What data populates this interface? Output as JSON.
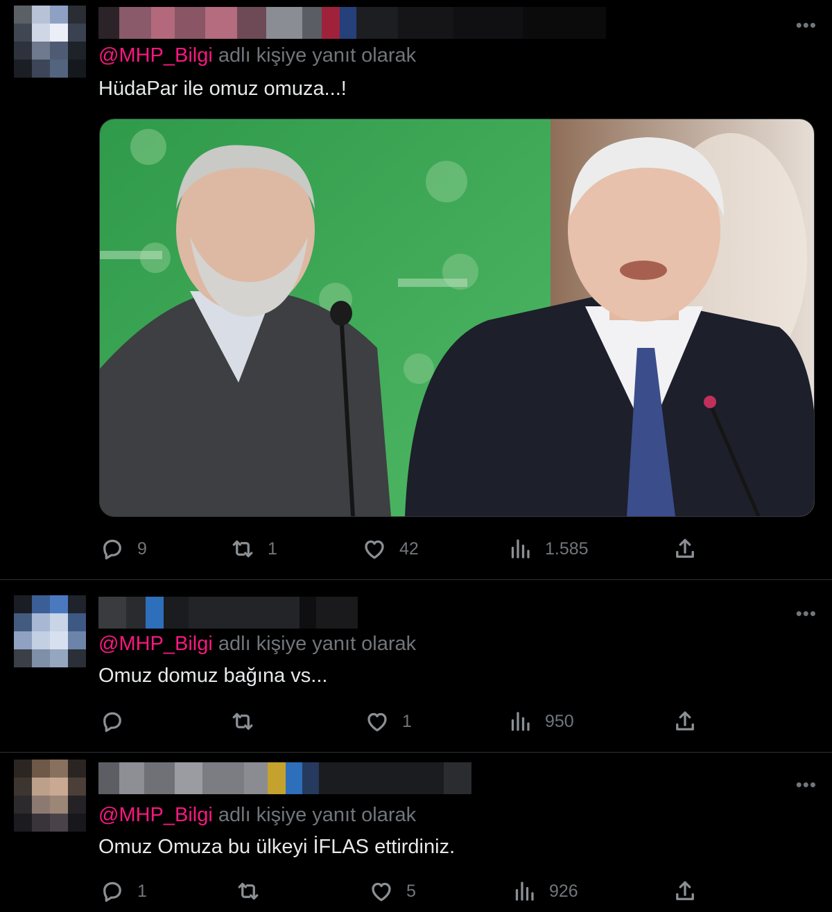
{
  "tweets": [
    {
      "reply_prefix": "@MHP_Bilgi",
      "reply_suffix": " adlı kişiye yanıt olarak",
      "text": "HüdaPar ile omuz omuza...!",
      "has_image": true,
      "image_alt": "İki siyasetçi mikrofon önünde",
      "stats": {
        "replies": "9",
        "retweets": "1",
        "likes": "42",
        "views": "1.585"
      }
    },
    {
      "reply_prefix": "@MHP_Bilgi",
      "reply_suffix": " adlı kişiye yanıt olarak",
      "text": "Omuz domuz bağına vs...",
      "has_image": false,
      "stats": {
        "replies": "",
        "retweets": "",
        "likes": "1",
        "views": "950"
      }
    },
    {
      "reply_prefix": "@MHP_Bilgi",
      "reply_suffix": " adlı kişiye yanıt olarak",
      "text": "Omuz Omuza bu ülkeyi İFLAS ettirdiniz.",
      "has_image": false,
      "stats": {
        "replies": "1",
        "retweets": "",
        "likes": "5",
        "views": "926"
      }
    }
  ],
  "more_label": "•••",
  "icons": {
    "reply": "reply-icon",
    "retweet": "retweet-icon",
    "like": "heart-icon",
    "views": "views-icon",
    "share": "share-icon",
    "more": "more-icon"
  },
  "colors": {
    "background": "#000000",
    "text": "#e7e9ea",
    "muted": "#71767b",
    "mention": "#f91880",
    "divider": "#2f3336"
  }
}
